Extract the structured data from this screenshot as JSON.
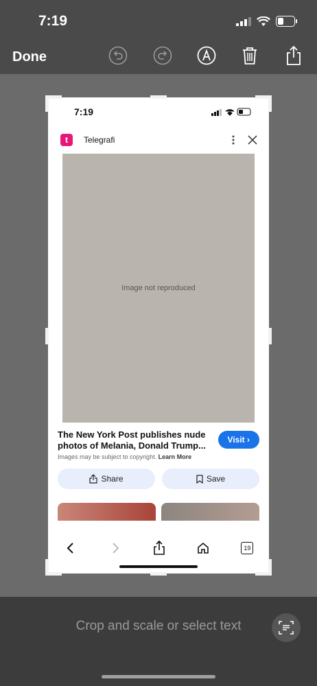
{
  "status_bar": {
    "time": "7:19"
  },
  "toolbar": {
    "done_label": "Done"
  },
  "screenshot": {
    "status_time": "7:19",
    "source_name": "Telegrafi",
    "source_logo_letter": "t",
    "image_placeholder": "Image not reproduced",
    "caption_title": "The New York Post publishes nude photos of Melania, Donald Trump...",
    "caption_note": "Images may be subject to copyright.",
    "caption_learn_more": "Learn More",
    "visit_label": "Visit ›",
    "share_label": "Share",
    "save_label": "Save",
    "tabs_count": "19"
  },
  "bottom": {
    "hint": "Crop and scale or select text"
  },
  "colors": {
    "accent": "#1a73e8",
    "brand": "#e6197a"
  }
}
